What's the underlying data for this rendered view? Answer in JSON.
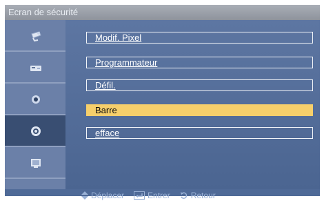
{
  "title": "Ecran de sécurité",
  "sidebar": {
    "items": [
      {
        "icon": "picture-icon"
      },
      {
        "icon": "sound-icon"
      },
      {
        "icon": "setup-icon"
      },
      {
        "icon": "gear-icon",
        "selected": true
      },
      {
        "icon": "multi-control-icon"
      }
    ]
  },
  "menu": {
    "items": [
      {
        "label": "Modif. Pixel"
      },
      {
        "label": "Programmateur"
      },
      {
        "label": "Défil."
      },
      {
        "label": "Barre",
        "selected": true
      },
      {
        "label": "efface"
      }
    ]
  },
  "footer": {
    "move_label": "Déplacer",
    "enter_label": "Entrer",
    "return_label": "Retour"
  },
  "colors": {
    "background": "#4f6a97",
    "highlight": "#f6cf6b",
    "sidebar": "#6b80a8"
  }
}
